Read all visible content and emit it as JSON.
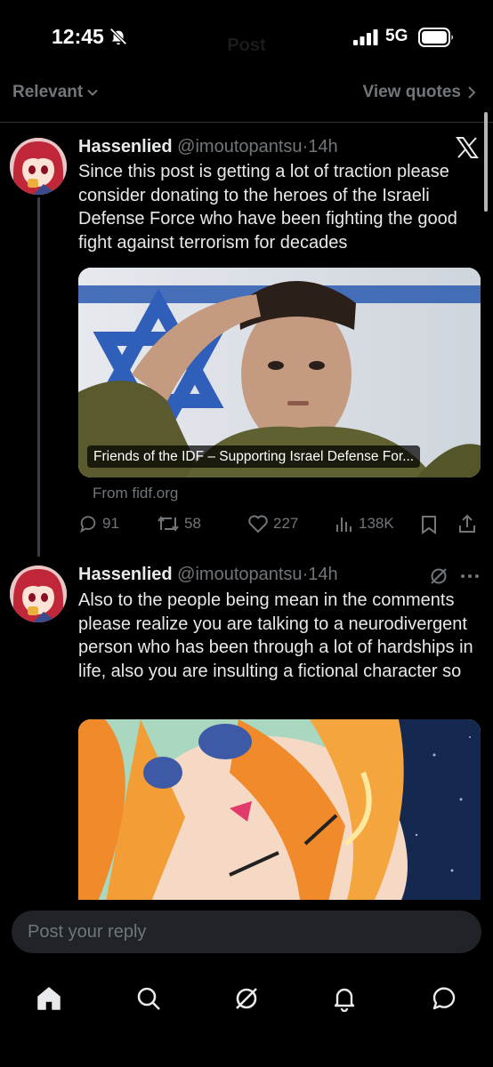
{
  "status_bar": {
    "time": "12:45",
    "network": "5G",
    "header_title": "Post"
  },
  "tabs": {
    "relevant": "Relevant",
    "view_quotes": "View quotes"
  },
  "posts": [
    {
      "author": "Hassenlied",
      "handle": "@imoutopantsu",
      "time": "·14h",
      "text": "Since this post is getting a lot of traction please consider donating to the heroes of the Israeli Defense Force who have been fighting the good fight against terrorism for decades",
      "card_title": "Friends of the IDF – Supporting Israel Defense For...",
      "card_source": "From fidf.org",
      "stats": {
        "replies": "91",
        "reposts": "58",
        "likes": "227",
        "views": "138K"
      }
    },
    {
      "author": "Hassenlied",
      "handle": "@imoutopantsu",
      "time": "·14h",
      "text": "Also to the people being mean in the comments please realize you are talking to a neurodivergent person who has been through a lot of hardships in life, also you are insulting a fictional character so"
    }
  ],
  "reply": {
    "placeholder": "Post your reply"
  },
  "icons": [
    "bell-slash-icon",
    "signal-icon",
    "battery-icon",
    "chevron-down-icon",
    "chevron-right-icon",
    "x-logo-icon",
    "grok-icon",
    "more-icon",
    "reply-icon",
    "repost-icon",
    "like-icon",
    "views-icon",
    "bookmark-icon",
    "share-icon",
    "home-icon",
    "search-icon",
    "notifications-icon",
    "messages-icon"
  ],
  "colors": {
    "background": "#000000",
    "text": "#e7e9ea",
    "muted": "#71767b",
    "divider": "#2f3336",
    "input_bg": "#202327"
  }
}
